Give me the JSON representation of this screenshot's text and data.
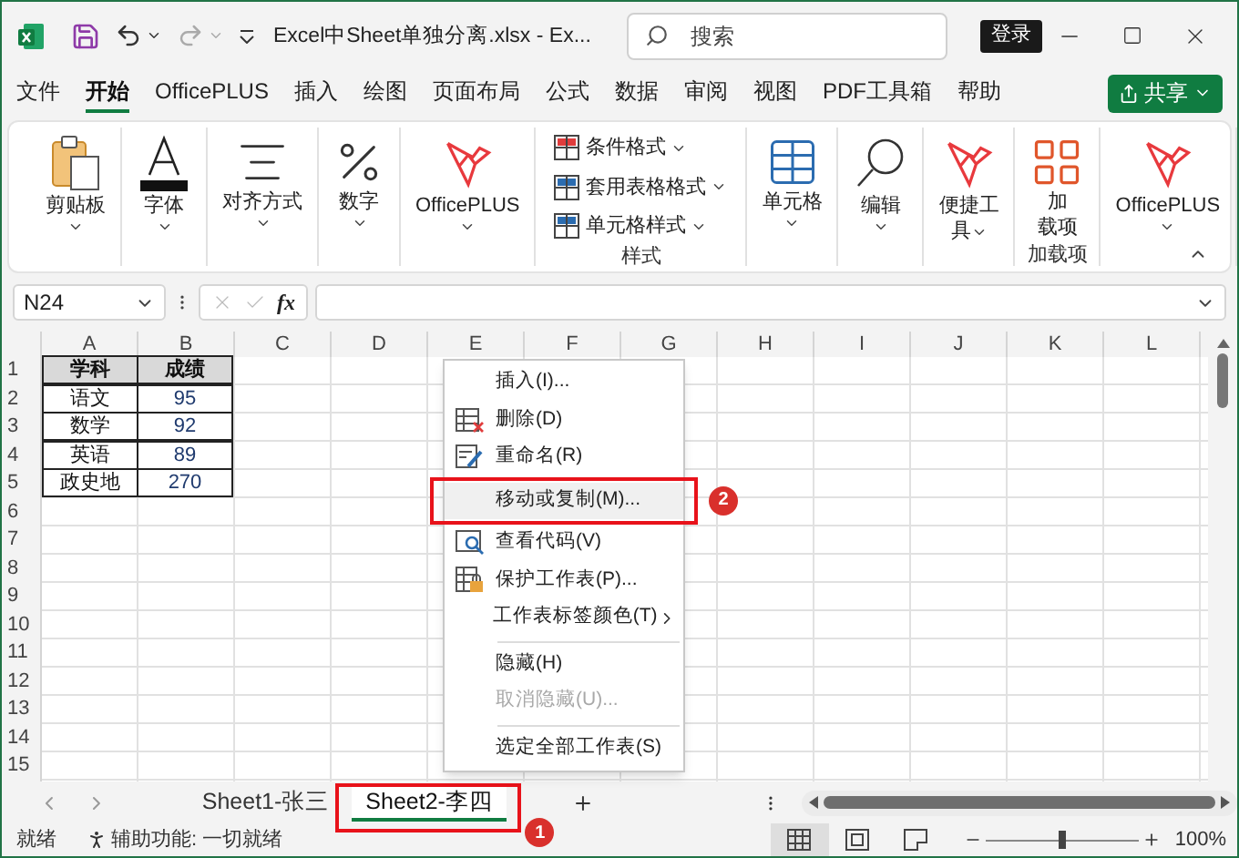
{
  "window": {
    "title": "Excel中Sheet单独分离.xlsx  -  Ex...",
    "search_placeholder": "搜索",
    "sign_in": "登录"
  },
  "menu_tabs": [
    {
      "label": "文件",
      "selected": false
    },
    {
      "label": "开始",
      "selected": true
    },
    {
      "label": "OfficePLUS",
      "selected": false
    },
    {
      "label": "插入",
      "selected": false
    },
    {
      "label": "绘图",
      "selected": false
    },
    {
      "label": "页面布局",
      "selected": false
    },
    {
      "label": "公式",
      "selected": false
    },
    {
      "label": "数据",
      "selected": false
    },
    {
      "label": "审阅",
      "selected": false
    },
    {
      "label": "视图",
      "selected": false
    },
    {
      "label": "PDF工具箱",
      "selected": false
    },
    {
      "label": "帮助",
      "selected": false
    }
  ],
  "share_button": "共享",
  "ribbon": {
    "groups": [
      {
        "kind": "clipboard",
        "label": "剪贴板"
      },
      {
        "kind": "font",
        "label": "字体"
      },
      {
        "kind": "align",
        "label": "对齐方式"
      },
      {
        "kind": "number",
        "label": "数字"
      },
      {
        "kind": "officeplus",
        "label": "OfficePLUS"
      },
      {
        "kind": "styles",
        "items": [
          "条件格式",
          "套用表格格式",
          "单元格样式"
        ],
        "group_label": "样式"
      },
      {
        "kind": "cells",
        "label": "单元格"
      },
      {
        "kind": "editing",
        "label": "编辑"
      },
      {
        "kind": "tools",
        "lines": [
          "便捷工",
          "具"
        ]
      },
      {
        "kind": "addins",
        "lines": [
          "加",
          "载项"
        ],
        "group_label": "加载项"
      },
      {
        "kind": "officeplus",
        "label": "OfficePLUS"
      }
    ]
  },
  "formula_bar": {
    "name_box": "N24",
    "function_label": "fx"
  },
  "sheet": {
    "columns": [
      "A",
      "B",
      "C",
      "D",
      "E",
      "F",
      "G",
      "H",
      "I",
      "J",
      "K",
      "L"
    ],
    "row_numbers": [
      "1",
      "2",
      "3",
      "4",
      "5",
      "6",
      "7",
      "8",
      "9",
      "10",
      "11",
      "12",
      "13",
      "14",
      "15"
    ],
    "table": {
      "header": [
        "学科",
        "成绩"
      ],
      "rows": [
        [
          "语文",
          "95"
        ],
        [
          "数学",
          "92"
        ],
        [
          "英语",
          "89"
        ],
        [
          "政史地",
          "270"
        ]
      ]
    }
  },
  "context_menu": {
    "items": [
      {
        "kind": "plain",
        "label": "插入(I)...",
        "selected": false,
        "disabled": false
      },
      {
        "kind": "delete",
        "label": "删除(D)",
        "selected": false,
        "disabled": false
      },
      {
        "kind": "rename",
        "label": "重命名(R)",
        "selected": false,
        "disabled": false
      },
      {
        "kind": "plain",
        "label": "移动或复制(M)...",
        "selected": true,
        "disabled": false,
        "callout": "2"
      },
      {
        "kind": "code",
        "label": "查看代码(V)",
        "selected": false,
        "disabled": false
      },
      {
        "kind": "protect",
        "label": "保护工作表(P)...",
        "selected": false,
        "disabled": false
      },
      {
        "kind": "submenu",
        "label": "工作表标签颜色(T)",
        "selected": false,
        "disabled": false
      },
      {
        "kind": "separator"
      },
      {
        "kind": "plain",
        "label": "隐藏(H)",
        "selected": false,
        "disabled": false
      },
      {
        "kind": "plain",
        "label": "取消隐藏(U)...",
        "selected": false,
        "disabled": true
      },
      {
        "kind": "separator"
      },
      {
        "kind": "plain",
        "label": "选定全部工作表(S)",
        "selected": false,
        "disabled": false
      }
    ]
  },
  "sheet_tabs": [
    {
      "label": "Sheet1-张三",
      "selected": false
    },
    {
      "label": "Sheet2-李四",
      "selected": true,
      "callout": "1"
    }
  ],
  "status_bar": {
    "ready": "就绪",
    "accessibility": "辅助功能: 一切就绪",
    "views": [
      {
        "kind": "normal",
        "selected": true
      },
      {
        "kind": "page_layout",
        "selected": false
      },
      {
        "kind": "page_break",
        "selected": false
      }
    ],
    "zoom": {
      "level": 0.5,
      "reading": "100%"
    }
  }
}
